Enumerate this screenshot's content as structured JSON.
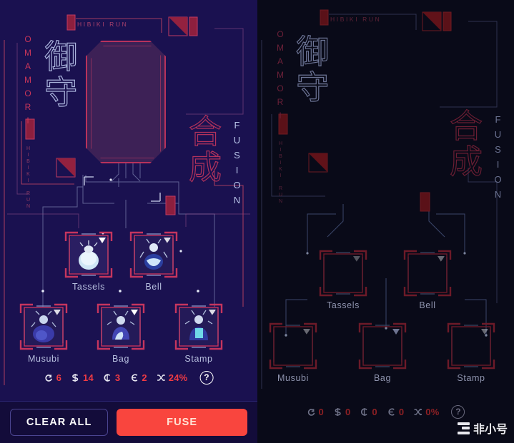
{
  "app": {
    "brand_top": "HIBIKI RUN",
    "brand_side": "HIBIKI RUN",
    "title_en": "OMAMORI",
    "title_jp": "御守",
    "section_en": "FUSION",
    "section_jp": "合成",
    "charm_label_jp": "御守"
  },
  "colors": {
    "accent_red": "#ef3b44",
    "fuse_button": "#f9453e",
    "frame_red": "#b8325c",
    "panel_left_bg": "#1a1150",
    "panel_right_bg": "#090a18",
    "label_text": "#b6bede"
  },
  "panels": [
    {
      "id": "left",
      "state": "filled",
      "slots": [
        {
          "name": "Tassels",
          "filled": true,
          "marker": "triangle-filled"
        },
        {
          "name": "Bell",
          "filled": true,
          "marker": "triangle-hollow"
        },
        {
          "name": "Musubi",
          "filled": true,
          "marker": "triangle-hollow"
        },
        {
          "name": "Bag",
          "filled": true,
          "marker": "triangle-filled"
        },
        {
          "name": "Stamp",
          "filled": true,
          "marker": "triangle-hollow"
        }
      ],
      "stats": [
        {
          "icon": "token-a-icon",
          "value": "6"
        },
        {
          "icon": "token-s-icon",
          "value": "14"
        },
        {
          "icon": "token-c-icon",
          "value": "3"
        },
        {
          "icon": "token-e-icon",
          "value": "2"
        },
        {
          "icon": "shuffle-icon",
          "value": "24%"
        }
      ],
      "help_label": "?",
      "buttons": {
        "clear_label": "CLEAR ALL",
        "fuse_label": "FUSE"
      }
    },
    {
      "id": "right",
      "state": "empty",
      "slots": [
        {
          "name": "Tassels",
          "filled": false,
          "marker": "triangle-hollow"
        },
        {
          "name": "Bell",
          "filled": false,
          "marker": "triangle-hollow"
        },
        {
          "name": "Musubi",
          "filled": false,
          "marker": "triangle-hollow"
        },
        {
          "name": "Bag",
          "filled": false,
          "marker": "triangle-filled"
        },
        {
          "name": "Stamp",
          "filled": false,
          "marker": "triangle-hollow"
        }
      ],
      "stats": [
        {
          "icon": "token-a-icon",
          "value": "0"
        },
        {
          "icon": "token-s-icon",
          "value": "0"
        },
        {
          "icon": "token-c-icon",
          "value": "0"
        },
        {
          "icon": "token-e-icon",
          "value": "0"
        },
        {
          "icon": "shuffle-icon",
          "value": "0%"
        }
      ],
      "help_label": "?"
    }
  ],
  "watermark": {
    "text": "非小号"
  }
}
